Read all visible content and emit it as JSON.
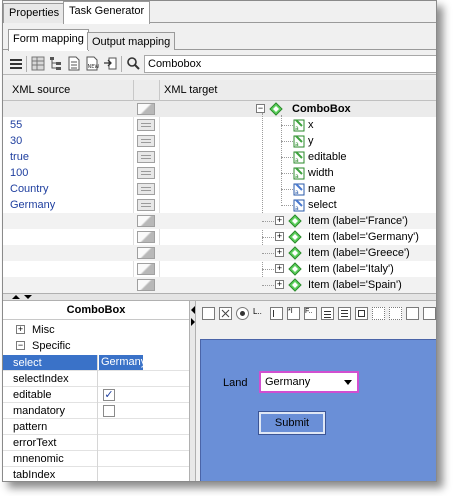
{
  "tabs": {
    "top": [
      "Properties",
      "Task Generator"
    ],
    "sub": [
      "Form mapping",
      "Output mapping"
    ]
  },
  "search": {
    "value": "Combobox"
  },
  "mapping": {
    "header": {
      "source": "XML source",
      "target": "XML target"
    },
    "root": "ComboBox",
    "attrs": [
      {
        "name": "x",
        "value": "55"
      },
      {
        "name": "y",
        "value": "30"
      },
      {
        "name": "editable",
        "value": "true"
      },
      {
        "name": "width",
        "value": "100"
      },
      {
        "name": "name",
        "value": "Country"
      },
      {
        "name": "select",
        "value": "Germany"
      }
    ],
    "items": [
      "Item (label='France')",
      "Item (label='Germany')",
      "Item (label='Greece')",
      "Item (label='Italy')",
      "Item (label='Spain')"
    ]
  },
  "properties": {
    "title": "ComboBox",
    "groups": {
      "misc": "Misc",
      "specific": "Specific"
    },
    "rows": [
      {
        "key": "select",
        "value": "Germany"
      },
      {
        "key": "selectIndex",
        "value": ""
      },
      {
        "key": "editable",
        "value": "✓"
      },
      {
        "key": "mandatory",
        "value": ""
      },
      {
        "key": "pattern",
        "value": ""
      },
      {
        "key": "errorText",
        "value": ""
      },
      {
        "key": "mnenomic",
        "value": ""
      },
      {
        "key": "tabIndex",
        "value": ""
      }
    ]
  },
  "preview": {
    "label": "Land",
    "combo_value": "Germany",
    "button": "Submit"
  }
}
